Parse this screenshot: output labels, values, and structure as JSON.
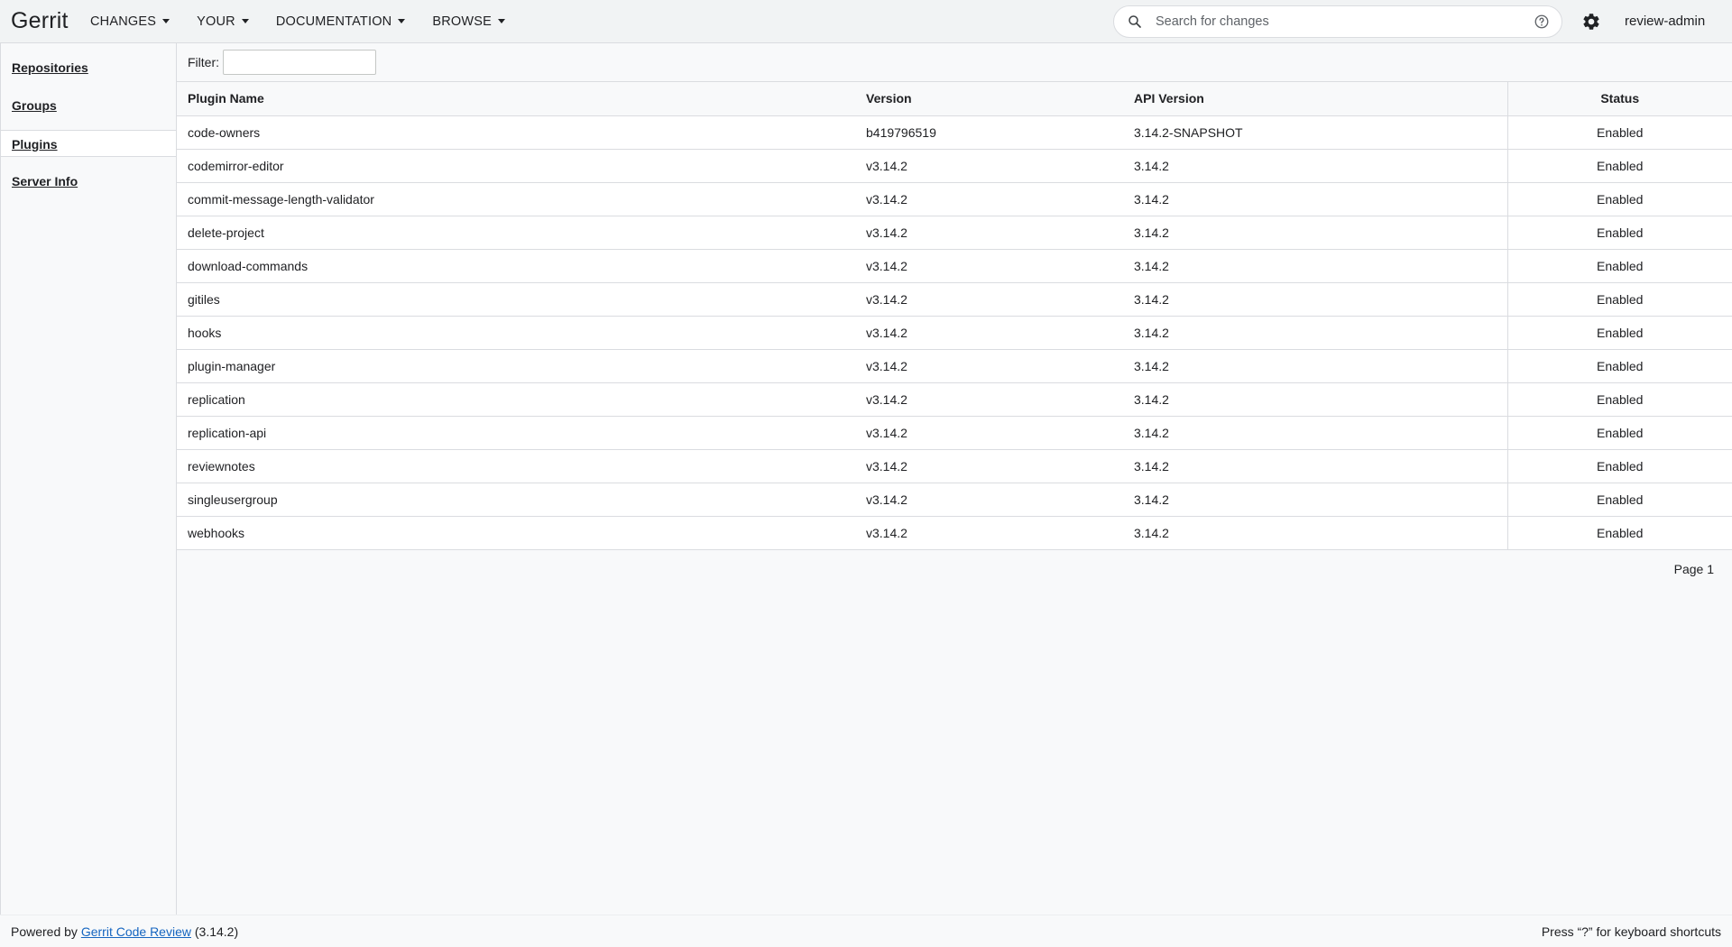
{
  "header": {
    "logo": "Gerrit",
    "menus": [
      {
        "label": "CHANGES"
      },
      {
        "label": "YOUR"
      },
      {
        "label": "DOCUMENTATION"
      },
      {
        "label": "BROWSE"
      }
    ],
    "search_placeholder": "Search for changes",
    "username": "review-admin",
    "icons": {
      "search": "search-icon",
      "help": "help-circle-icon",
      "settings": "gear-icon",
      "caret": "caret-down-icon"
    }
  },
  "sidebar": {
    "items": [
      {
        "label": "Repositories"
      },
      {
        "label": "Groups"
      },
      {
        "label": "Plugins",
        "selected": true
      },
      {
        "label": "Server Info"
      }
    ]
  },
  "filter": {
    "label": "Filter:",
    "value": ""
  },
  "table": {
    "headers": {
      "name": "Plugin Name",
      "version": "Version",
      "api_version": "API Version",
      "status": "Status"
    },
    "rows": [
      {
        "name": "code-owners",
        "version": "b419796519",
        "api_version": "3.14.2-SNAPSHOT",
        "status": "Enabled"
      },
      {
        "name": "codemirror-editor",
        "version": "v3.14.2",
        "api_version": "3.14.2",
        "status": "Enabled"
      },
      {
        "name": "commit-message-length-validator",
        "version": "v3.14.2",
        "api_version": "3.14.2",
        "status": "Enabled"
      },
      {
        "name": "delete-project",
        "version": "v3.14.2",
        "api_version": "3.14.2",
        "status": "Enabled"
      },
      {
        "name": "download-commands",
        "version": "v3.14.2",
        "api_version": "3.14.2",
        "status": "Enabled"
      },
      {
        "name": "gitiles",
        "version": "v3.14.2",
        "api_version": "3.14.2",
        "status": "Enabled"
      },
      {
        "name": "hooks",
        "version": "v3.14.2",
        "api_version": "3.14.2",
        "status": "Enabled"
      },
      {
        "name": "plugin-manager",
        "version": "v3.14.2",
        "api_version": "3.14.2",
        "status": "Enabled"
      },
      {
        "name": "replication",
        "version": "v3.14.2",
        "api_version": "3.14.2",
        "status": "Enabled"
      },
      {
        "name": "replication-api",
        "version": "v3.14.2",
        "api_version": "3.14.2",
        "status": "Enabled"
      },
      {
        "name": "reviewnotes",
        "version": "v3.14.2",
        "api_version": "3.14.2",
        "status": "Enabled"
      },
      {
        "name": "singleusergroup",
        "version": "v3.14.2",
        "api_version": "3.14.2",
        "status": "Enabled"
      },
      {
        "name": "webhooks",
        "version": "v3.14.2",
        "api_version": "3.14.2",
        "status": "Enabled"
      }
    ]
  },
  "pager": {
    "label": "Page 1"
  },
  "footer": {
    "powered_prefix": "Powered by",
    "link_text": "Gerrit Code Review",
    "version_suffix": "(3.14.2)",
    "shortcuts_hint": "Press “?” for keyboard shortcuts"
  },
  "colors": {
    "header_bg": "#f1f3f4",
    "page_bg": "#f8f9fa",
    "border": "#dadce0",
    "link": "#1565c0"
  }
}
